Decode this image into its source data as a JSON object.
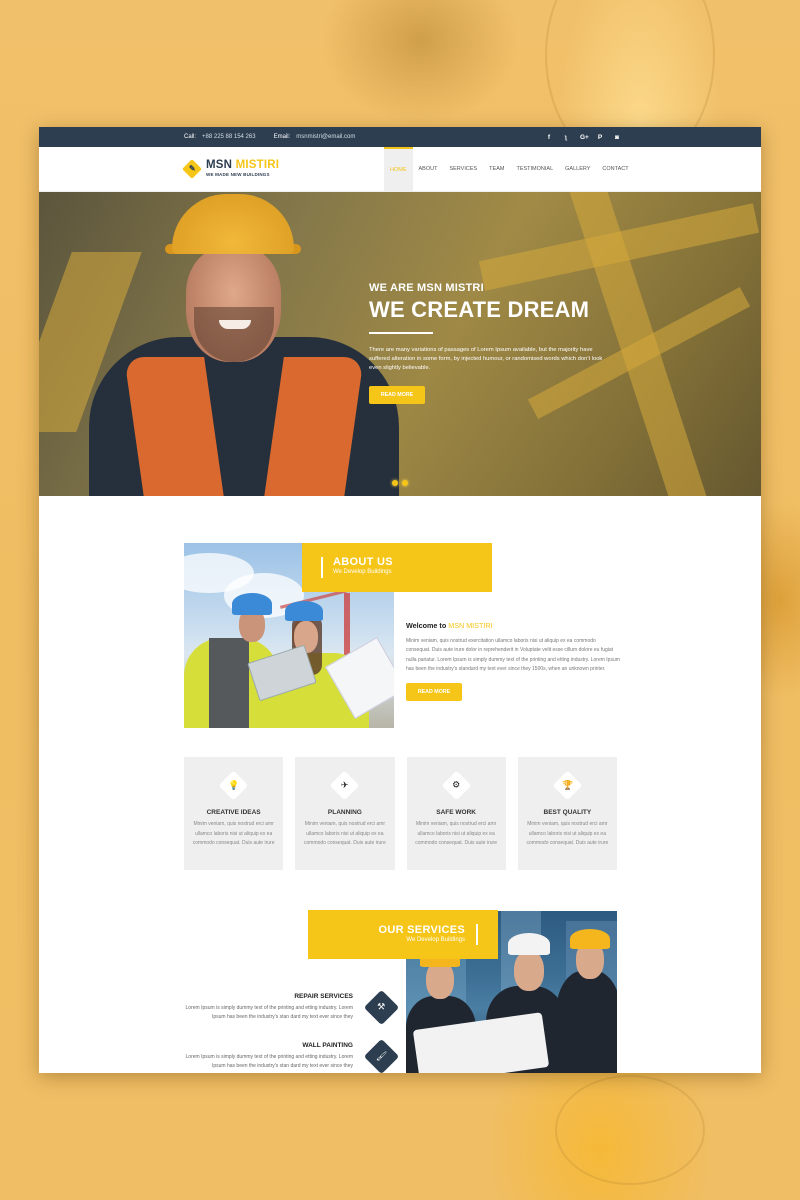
{
  "topbar": {
    "call_label": "Call:",
    "call_value": "+88 225 88 154 263",
    "email_label": "Email:",
    "email_value": "msnmistri@email.com",
    "social": [
      {
        "icon": "facebook-icon",
        "glyph": "f"
      },
      {
        "icon": "rss-icon",
        "glyph": "ʅ"
      },
      {
        "icon": "google-plus-icon",
        "glyph": "G+"
      },
      {
        "icon": "pinterest-icon",
        "glyph": "P"
      },
      {
        "icon": "instagram-icon",
        "glyph": "◙"
      }
    ]
  },
  "header": {
    "logo_primary": "MSN",
    "logo_accent": "MISTIRI",
    "logo_tagline": "WE MADE NEW BUILDINGS",
    "logo_icon_glyph": "🔧",
    "nav": [
      {
        "label": "HOME",
        "active": true
      },
      {
        "label": "ABOUT"
      },
      {
        "label": "SERVICES"
      },
      {
        "label": "TEAM"
      },
      {
        "label": "TESTIMONIAL"
      },
      {
        "label": "GALLERY"
      },
      {
        "label": "CONTACT"
      }
    ]
  },
  "hero": {
    "kicker": "WE ARE MSN MISTRI",
    "title": "WE CREATE DREAM",
    "text": "There are many variations of passages of Lorem Ipsum available, but the majority have suffered alteration in some form, by injected humour, or randomised words which don't look even slightly believable.",
    "button": "READ MORE",
    "slides": 2,
    "active_slide": 1
  },
  "about": {
    "banner_title": "ABOUT US",
    "banner_sub": "We Develop Buildings",
    "welcome_prefix": "Welcome to",
    "welcome_accent": "MSN MISTIRI",
    "text": "Minim veniam, quis nostrud exercitation ullamco laboris nisi ut aliquip ex ea commodo consequat. Duis aute irure dolor in reprehenderit in Voluptate velit esse cillum dolore eu fugiat nulla pariatur. Lorem Ipsum is simply dummy text of the printing and etting industry. Lorem Ipsum has been the industry's standard my text ever since they 1500s, when an unknown printer.",
    "button": "READ MORE"
  },
  "features": [
    {
      "title": "CREATIVE IDEAS",
      "icon": "lightbulb-icon",
      "glyph": "💡",
      "text": "Minim veniam, quis nostrud erci amr ullamco laboris nisi ut aliquip ex ea commodo consequat. Duis aute irure"
    },
    {
      "title": "PLANNING",
      "icon": "paper-plane-icon",
      "glyph": "✈",
      "text": "Minim veniam, quis nostrud erci amr ullamco laboris nisi ut aliquip ex ea commodo consequat. Duis aute irure"
    },
    {
      "title": "SAFE WORK",
      "icon": "gear-icon",
      "glyph": "⚙",
      "text": "Minim veniam, quis nostrud erci amr ullamco laboris nisi ut aliquip ex ea commodo consequat. Duis aute irure"
    },
    {
      "title": "BEST QUALITY",
      "icon": "trophy-icon",
      "glyph": "🏆",
      "text": "Minim veniam, quis nostrud erci amr ullamco laboris nisi ut aliquip ex ea commodo consequat. Duis aute irure"
    }
  ],
  "services": {
    "banner_title": "OUR SERVICES",
    "banner_sub": "We Develop Buildings",
    "items": [
      {
        "title": "REPAIR SERVICES",
        "icon": "drill-icon",
        "glyph": "⚒",
        "text": "Lorem Ipsum is simply dummy text of the printing and etting industry. Lorem Ipsum has been the industry's stan dard my text ever since they"
      },
      {
        "title": "WALL PAINTING",
        "icon": "paint-roller-icon",
        "glyph": "🖌",
        "text": "Lorem Ipsum is simply dummy text of the printing and etting industry. Lorem Ipsum has been the industry's stan dard my text ever since they"
      }
    ]
  },
  "colors": {
    "accent": "#f5c518",
    "dark": "#2d3e50",
    "background": "#f0be64"
  }
}
